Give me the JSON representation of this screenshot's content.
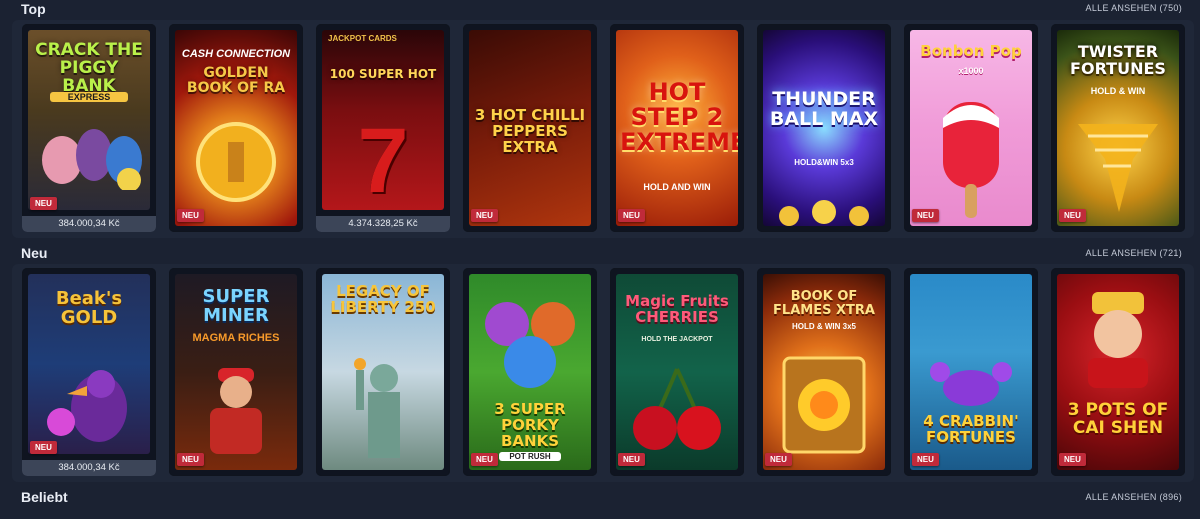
{
  "sections": [
    {
      "title": "Top",
      "see_all": "ALLE ANSEHEN (750)"
    },
    {
      "title": "Neu",
      "see_all": "ALLE ANSEHEN (721)"
    },
    {
      "title": "Beliebt",
      "see_all": "ALLE ANSEHEN (896)"
    }
  ],
  "badge_new": "NEU",
  "top_games": [
    {
      "title": "CRACK THE PIGGY BANK",
      "sub": "EXPRESS",
      "jackpot": "384.000,34 Kč"
    },
    {
      "title": "GOLDEN BOOK OF RA",
      "sub": "CASH CONNECTION"
    },
    {
      "title": "100 SUPER HOT",
      "sub": "JACKPOT CARDS",
      "jackpot": "4.374.328,25 Kč"
    },
    {
      "title": "3 HOT CHILLI PEPPERS EXTRA"
    },
    {
      "title": "HOT STEP 2 EXTREME",
      "sub": "HOLD AND WIN"
    },
    {
      "title": "THUNDER BALL MAX",
      "sub": "HOLD&WIN 5x3"
    },
    {
      "title": "Bonbon Pop",
      "sub": "x1000"
    },
    {
      "title": "TWISTER FORTUNES",
      "sub": "HOLD & WIN"
    }
  ],
  "new_games": [
    {
      "title": "Beak's GOLD",
      "jackpot": "384.000,34 Kč"
    },
    {
      "title": "SUPER MINER",
      "sub": "MAGMA RICHES"
    },
    {
      "title": "LEGACY OF LIBERTY 250"
    },
    {
      "title": "3 SUPER PORKY BANKS",
      "sub": "POT RUSH"
    },
    {
      "title": "Magic Fruits CHERRIES",
      "sub": "HOLD THE JACKPOT"
    },
    {
      "title": "BOOK OF FLAMES XTRA",
      "sub": "HOLD & WIN 3x5"
    },
    {
      "title": "4 CRABBIN' FORTUNES"
    },
    {
      "title": "3 POTS OF CAI SHEN"
    }
  ],
  "colors": {
    "background": "#1b2232",
    "row": "#1f2738",
    "badge": "#c02a3a"
  }
}
